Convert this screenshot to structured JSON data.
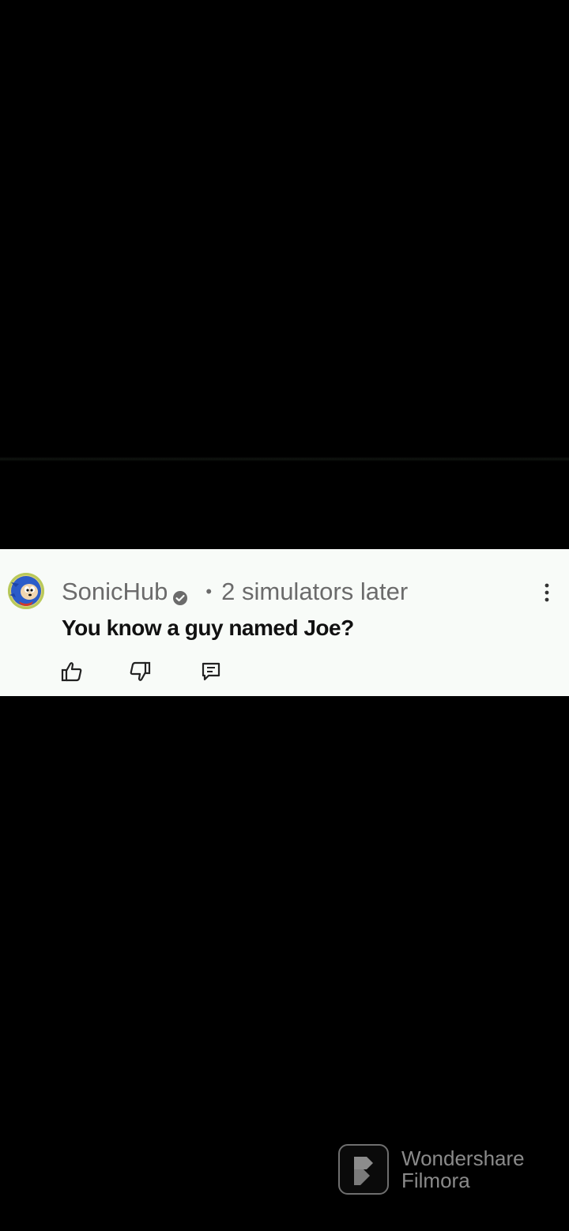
{
  "comment": {
    "author": "SonicHub",
    "timestamp": "2 simulators later",
    "separator": "•",
    "text": "You know a guy named Joe?",
    "avatar_icon": "sonic-avatar-icon",
    "verified_icon": "verified-check-icon",
    "more_icon": "more-vert-icon",
    "actions": [
      {
        "name": "like",
        "icon": "thumbs-up-icon"
      },
      {
        "name": "dislike",
        "icon": "thumbs-down-icon"
      },
      {
        "name": "reply",
        "icon": "reply-icon"
      }
    ]
  },
  "watermark": {
    "line1": "Wondershare",
    "line2": "Filmora",
    "logo_icon": "filmora-logo-icon"
  },
  "colors": {
    "background": "#000000",
    "card": "#f8fbf8",
    "author_text": "#6b6b6b",
    "comment_text": "#111111",
    "watermark_text": "#8a8a8a"
  }
}
